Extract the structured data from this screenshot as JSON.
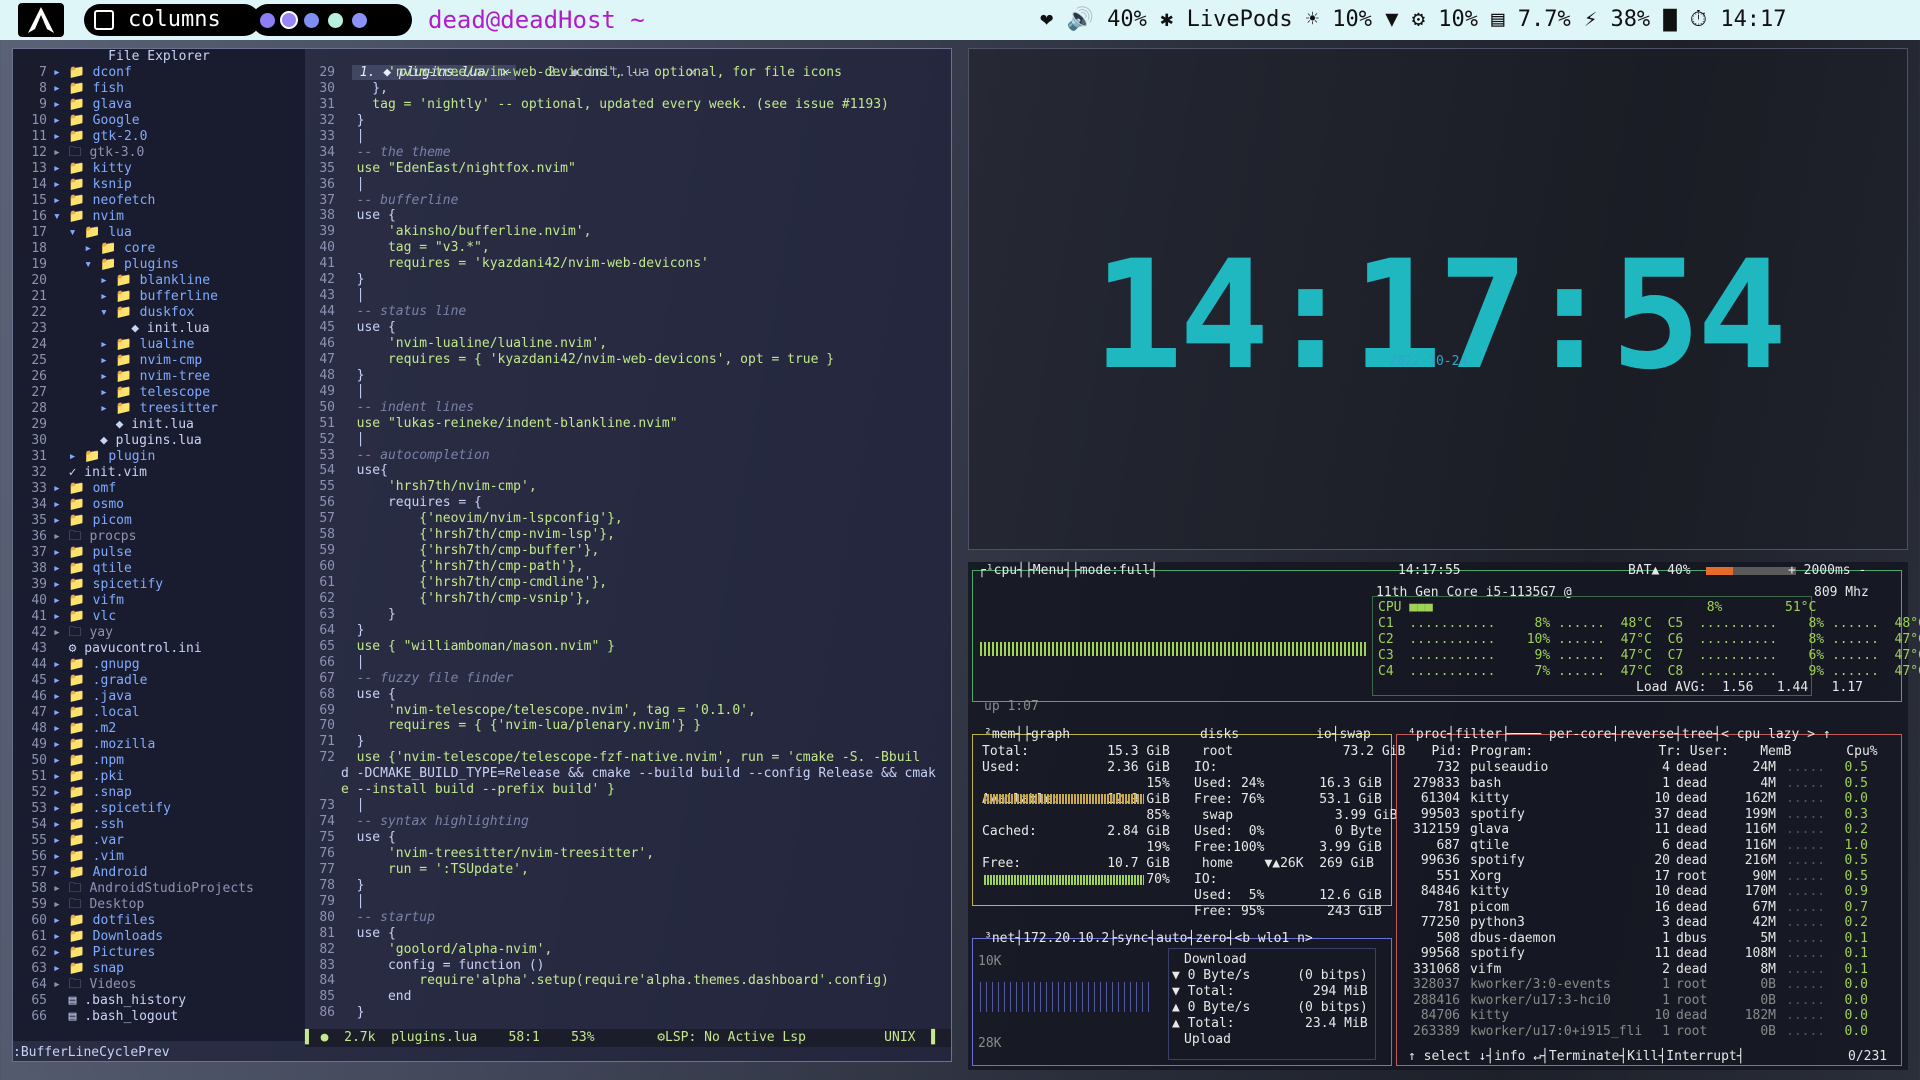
{
  "topbar": {
    "layout": "columns",
    "title": "dead@deadHost ~",
    "status": "❤ 🔊 40%  ✱ LivePods  ☀ 10% ▼  ⚙ 10% ▤ 7.7% ⚡ 38% ▇ ⏱ 14:17",
    "workspace_colors": [
      "#8c7ef5",
      "#9a86f8",
      "#7e8ef2",
      "#b7f1dd",
      "#8a91f7"
    ]
  },
  "editor": {
    "file_explorer_title": "File Explorer",
    "tree": [
      [
        "7",
        "▸ 📁 dconf",
        "folder"
      ],
      [
        "8",
        "▸ 📁 fish",
        "folder"
      ],
      [
        "9",
        "▸ 📁 glava",
        "folder"
      ],
      [
        "10",
        "▸ 📁 Google",
        "folder"
      ],
      [
        "11",
        "▸ 📁 gtk-2.0",
        "folder"
      ],
      [
        "12",
        "▸ 🗀 gtk-3.0",
        "gray"
      ],
      [
        "13",
        "▸ 📁 kitty",
        "folder"
      ],
      [
        "14",
        "▸ 📁 ksnip",
        "folder"
      ],
      [
        "15",
        "▸ 📁 neofetch",
        "folder"
      ],
      [
        "16",
        "▾ 📁 nvim",
        "folder"
      ],
      [
        "17",
        "  ▾ 📁 lua",
        "folder"
      ],
      [
        "18",
        "    ▸ 📁 core",
        "folder"
      ],
      [
        "19",
        "    ▾ 📁 plugins",
        "folder"
      ],
      [
        "20",
        "      ▸ 📁 blankline",
        "folder"
      ],
      [
        "21",
        "      ▸ 📁 bufferline",
        "folder"
      ],
      [
        "22",
        "      ▾ 📁 duskfox",
        "folder"
      ],
      [
        "23",
        "          ◆ init.lua",
        "file"
      ],
      [
        "24",
        "      ▸ 📁 lualine",
        "folder"
      ],
      [
        "25",
        "      ▸ 📁 nvim-cmp",
        "folder"
      ],
      [
        "26",
        "      ▸ 📁 nvim-tree",
        "folder"
      ],
      [
        "27",
        "      ▸ 📁 telescope",
        "folder"
      ],
      [
        "28",
        "      ▸ 📁 treesitter",
        "folder"
      ],
      [
        "29",
        "        ◆ init.lua",
        "file"
      ],
      [
        "30",
        "      ◆ plugins.lua",
        "file"
      ],
      [
        "31",
        "  ▸ 📁 plugin",
        "folder"
      ],
      [
        "32",
        "  ✓ init.vim",
        "file"
      ],
      [
        "33",
        "▸ 📁 omf",
        "folder"
      ],
      [
        "34",
        "▸ 📁 osmo",
        "folder"
      ],
      [
        "35",
        "▸ 📁 picom",
        "folder"
      ],
      [
        "36",
        "▸ 🗀 procps",
        "gray"
      ],
      [
        "37",
        "▸ 📁 pulse",
        "folder"
      ],
      [
        "38",
        "▸ 📁 qtile",
        "folder"
      ],
      [
        "39",
        "▸ 📁 spicetify",
        "folder"
      ],
      [
        "40",
        "▸ 📁 vifm",
        "folder"
      ],
      [
        "41",
        "▸ 📁 vlc",
        "folder"
      ],
      [
        "42",
        "▸ 🗀 yay",
        "gray"
      ],
      [
        "43",
        "  ⚙ pavucontrol.ini",
        "file"
      ],
      [
        "44",
        "▸ 📁 .gnupg",
        "folder"
      ],
      [
        "45",
        "▸ 📁 .gradle",
        "folder"
      ],
      [
        "46",
        "▸ 📁 .java",
        "folder"
      ],
      [
        "47",
        "▸ 📁 .local",
        "folder"
      ],
      [
        "48",
        "▸ 📁 .m2",
        "folder"
      ],
      [
        "49",
        "▸ 📁 .mozilla",
        "folder"
      ],
      [
        "50",
        "▸ 📁 .npm",
        "folder"
      ],
      [
        "51",
        "▸ 📁 .pki",
        "folder"
      ],
      [
        "52",
        "▸ 📁 .snap",
        "folder"
      ],
      [
        "53",
        "▸ 📁 .spicetify",
        "folder"
      ],
      [
        "54",
        "▸ 📁 .ssh",
        "folder"
      ],
      [
        "55",
        "▸ 📁 .var",
        "folder"
      ],
      [
        "56",
        "▸ 📁 .vim",
        "folder"
      ],
      [
        "57",
        "▸ 📁 Android",
        "folder"
      ],
      [
        "58",
        "▸ 🗀 AndroidStudioProjects",
        "gray"
      ],
      [
        "59",
        "▸ 🗀 Desktop",
        "gray"
      ],
      [
        "60",
        "▸ 📁 dotfiles",
        "folder"
      ],
      [
        "61",
        "▸ 📁 Downloads",
        "folder"
      ],
      [
        "62",
        "▸ 📁 Pictures",
        "folder"
      ],
      [
        "63",
        "▸ 📁 snap",
        "folder"
      ],
      [
        "64",
        "▸ 🗀 Videos",
        "gray"
      ],
      [
        "65",
        "  ▤ .bash_history",
        "file"
      ],
      [
        "66",
        "  ▤ .bash_logout",
        "file"
      ]
    ],
    "tabs": [
      " 1. ◆ plugins.lua  ✕ ",
      "    2. ◆ init.lua     ✕"
    ],
    "code": [
      [
        "29",
        "      'nvim-tree/nvim-web-devicons', -- optional, for file icons"
      ],
      [
        "30",
        "    },"
      ],
      [
        "31",
        "    tag = 'nightly' -- optional, updated every week. (see issue #1193)"
      ],
      [
        "32",
        "  }"
      ],
      [
        "33",
        "  │"
      ],
      [
        "34",
        "  -- the theme"
      ],
      [
        "35",
        "  use \"EdenEast/nightfox.nvim\""
      ],
      [
        "36",
        "  │"
      ],
      [
        "37",
        "  -- bufferline"
      ],
      [
        "38",
        "  use {"
      ],
      [
        "39",
        "      'akinsho/bufferline.nvim',"
      ],
      [
        "40",
        "      tag = \"v3.*\","
      ],
      [
        "41",
        "      requires = 'kyazdani42/nvim-web-devicons'"
      ],
      [
        "42",
        "  }"
      ],
      [
        "43",
        "  │"
      ],
      [
        "44",
        "  -- status line"
      ],
      [
        "45",
        "  use {"
      ],
      [
        "46",
        "      'nvim-lualine/lualine.nvim',"
      ],
      [
        "47",
        "      requires = { 'kyazdani42/nvim-web-devicons', opt = true }"
      ],
      [
        "48",
        "  }"
      ],
      [
        "49",
        "  │"
      ],
      [
        "50",
        "  -- indent lines"
      ],
      [
        "51",
        "  use \"lukas-reineke/indent-blankline.nvim\""
      ],
      [
        "52",
        "  │"
      ],
      [
        "53",
        "  -- autocompletion"
      ],
      [
        "54",
        "  use{"
      ],
      [
        "55",
        "      'hrsh7th/nvim-cmp',"
      ],
      [
        "56",
        "      requires = {"
      ],
      [
        "57",
        "          {'neovim/nvim-lspconfig'},"
      ],
      [
        "58",
        "          {'hrsh7th/cmp-nvim-lsp'},"
      ],
      [
        "59",
        "          {'hrsh7th/cmp-buffer'},"
      ],
      [
        "60",
        "          {'hrsh7th/cmp-path'},"
      ],
      [
        "61",
        "          {'hrsh7th/cmp-cmdline'},"
      ],
      [
        "62",
        "          {'hrsh7th/cmp-vsnip'},"
      ],
      [
        "63",
        "      }"
      ],
      [
        "64",
        "  }"
      ],
      [
        "65",
        "  use { \"williamboman/mason.nvim\" }"
      ],
      [
        "66",
        "  │"
      ],
      [
        "67",
        "  -- fuzzy file finder"
      ],
      [
        "68",
        "  use {"
      ],
      [
        "69",
        "      'nvim-telescope/telescope.nvim', tag = '0.1.0',"
      ],
      [
        "70",
        "      requires = { {'nvim-lua/plenary.nvim'} }"
      ],
      [
        "71",
        "  }"
      ],
      [
        "72",
        "  use {'nvim-telescope/telescope-fzf-native.nvim', run = 'cmake -S. -Bbuil"
      ],
      [
        "",
        "d -DCMAKE_BUILD_TYPE=Release && cmake --build build --config Release && cmak"
      ],
      [
        "",
        "e --install build --prefix build' }"
      ],
      [
        "73",
        "  │"
      ],
      [
        "74",
        "  -- syntax highlighting"
      ],
      [
        "75",
        "  use {"
      ],
      [
        "76",
        "      'nvim-treesitter/nvim-treesitter',"
      ],
      [
        "77",
        "      run = ':TSUpdate',"
      ],
      [
        "78",
        "  }"
      ],
      [
        "79",
        "  │"
      ],
      [
        "80",
        "  -- startup"
      ],
      [
        "81",
        "  use {"
      ],
      [
        "82",
        "      'goolord/alpha-nvim',"
      ],
      [
        "83",
        "      config = function ()"
      ],
      [
        "84",
        "          require'alpha'.setup(require'alpha.themes.dashboard'.config)"
      ],
      [
        "85",
        "      end"
      ],
      [
        "86",
        "  }"
      ]
    ],
    "statusline": "▌ ●  2.7k  plugins.lua    58:1    53%        ⚙LSP: No Active Lsp          UNIX  ▌",
    "cmdline": ":BufferLineCyclePrev"
  },
  "clock": {
    "time": "14:17:54",
    "date": "2022-10-24"
  },
  "btop": {
    "cpu_header": "┌¹cpu┤├Menu┤├mode:full┤",
    "clock_center": "14:17:55",
    "battery": "BAT▲ 40%",
    "interval": "+ 2000ms -",
    "cpu_model": "11th Gen Core i5-1135G7 @",
    "freq": "809 Mhz",
    "cpu_rows": [
      "CPU ■■■                                   8%        51°C",
      "C1  ...........     8% ......  48°C  C5  ..........    8% ......  48°C",
      "C2  ...........    10% ......  47°C  C6  ..........    8% ......  47°C",
      "C3  ...........     9% ......  47°C  C7  ..........    6% ......  47°C",
      "C4  ...........     7% ......  47°C  C8  ..........    9% ......  47°C"
    ],
    "load": "Load AVG:  1.56   1.44   1.17",
    "uptime": "up 1:07",
    "mem_header": "²mem┤├graph",
    "mem_rows": [
      "Total:          15.3 GiB",
      "Used:           2.36 GiB",
      "                     15%",
      "Available:      12.9 GiB",
      "                     85%",
      "Cached:         2.84 GiB",
      "                     19%",
      "Free:           10.7 GiB",
      "                     70%"
    ],
    "disk_header": "disks",
    "io_swap": "io┤swap",
    "disk_rows": [
      " root              73.2 GiB",
      "IO:",
      "Used: 24%       16.3 GiB",
      "Free: 76%       53.1 GiB",
      " swap             3.99 GiB",
      "Used:  0%         0 Byte",
      "Free:100%       3.99 GiB",
      " home    ▼▲26K  269 GiB",
      "IO:",
      "Used:  5%       12.6 GiB",
      "Free: 95%        243 GiB"
    ],
    "net_header": "³net┤172.20.10.2├sync┤auto┤zero┤<b wlo1 n>",
    "net_rows": [
      "▼ 0 Byte/s      (0 bitps)",
      "▼ Total:          294 MiB",
      "▲ 0 Byte/s      (0 bitps)",
      "▲ Total:         23.4 MiB"
    ],
    "net_scale_top": "10K",
    "net_scale_bot": "28K",
    "net_download": "Download",
    "net_upload": "Upload",
    "proc_header": "⁴proc┤filter├──── per-core┤reverse┤tree┤< cpu lazy > ↑",
    "proc_cols": "   Pid: Program:                Tr: User:    MemB       Cpu%",
    "procs": [
      [
        "732",
        "pulseaudio",
        "4",
        "dead",
        "24M",
        "0.5"
      ],
      [
        "279833",
        "bash",
        "1",
        "dead",
        "4M",
        "0.5"
      ],
      [
        "61304",
        "kitty",
        "10",
        "dead",
        "162M",
        "0.0"
      ],
      [
        "99503",
        "spotify",
        "37",
        "dead",
        "199M",
        "0.3"
      ],
      [
        "312159",
        "glava",
        "11",
        "dead",
        "116M",
        "0.2"
      ],
      [
        "687",
        "qtile",
        "6",
        "dead",
        "116M",
        "1.0"
      ],
      [
        "99636",
        "spotify",
        "20",
        "dead",
        "216M",
        "0.5"
      ],
      [
        "551",
        "Xorg",
        "17",
        "root",
        "90M",
        "0.5"
      ],
      [
        "84846",
        "kitty",
        "10",
        "dead",
        "170M",
        "0.9"
      ],
      [
        "781",
        "picom",
        "16",
        "dead",
        "67M",
        "0.7"
      ],
      [
        "77250",
        "python3",
        "3",
        "dead",
        "42M",
        "0.2"
      ],
      [
        "508",
        "dbus-daemon",
        "1",
        "dbus",
        "5M",
        "0.1"
      ],
      [
        "99568",
        "spotify",
        "11",
        "dead",
        "108M",
        "0.1"
      ],
      [
        "331068",
        "vifm",
        "2",
        "dead",
        "8M",
        "0.1"
      ],
      [
        "328037",
        "kworker/3:0-events",
        "1",
        "root",
        "0B",
        "0.0"
      ],
      [
        "288416",
        "kworker/u17:3-hci0",
        "1",
        "root",
        "0B",
        "0.0"
      ],
      [
        "84706",
        "kitty",
        "10",
        "dead",
        "182M",
        "0.0"
      ],
      [
        "263389",
        "kworker/u17:0+i915_fli",
        "1",
        "root",
        "0B",
        "0.0"
      ]
    ],
    "proc_footer": "↑ select ↓┤info ↵┤Terminate┤Kill┤Interrupt┤",
    "proc_count": "0/231"
  }
}
